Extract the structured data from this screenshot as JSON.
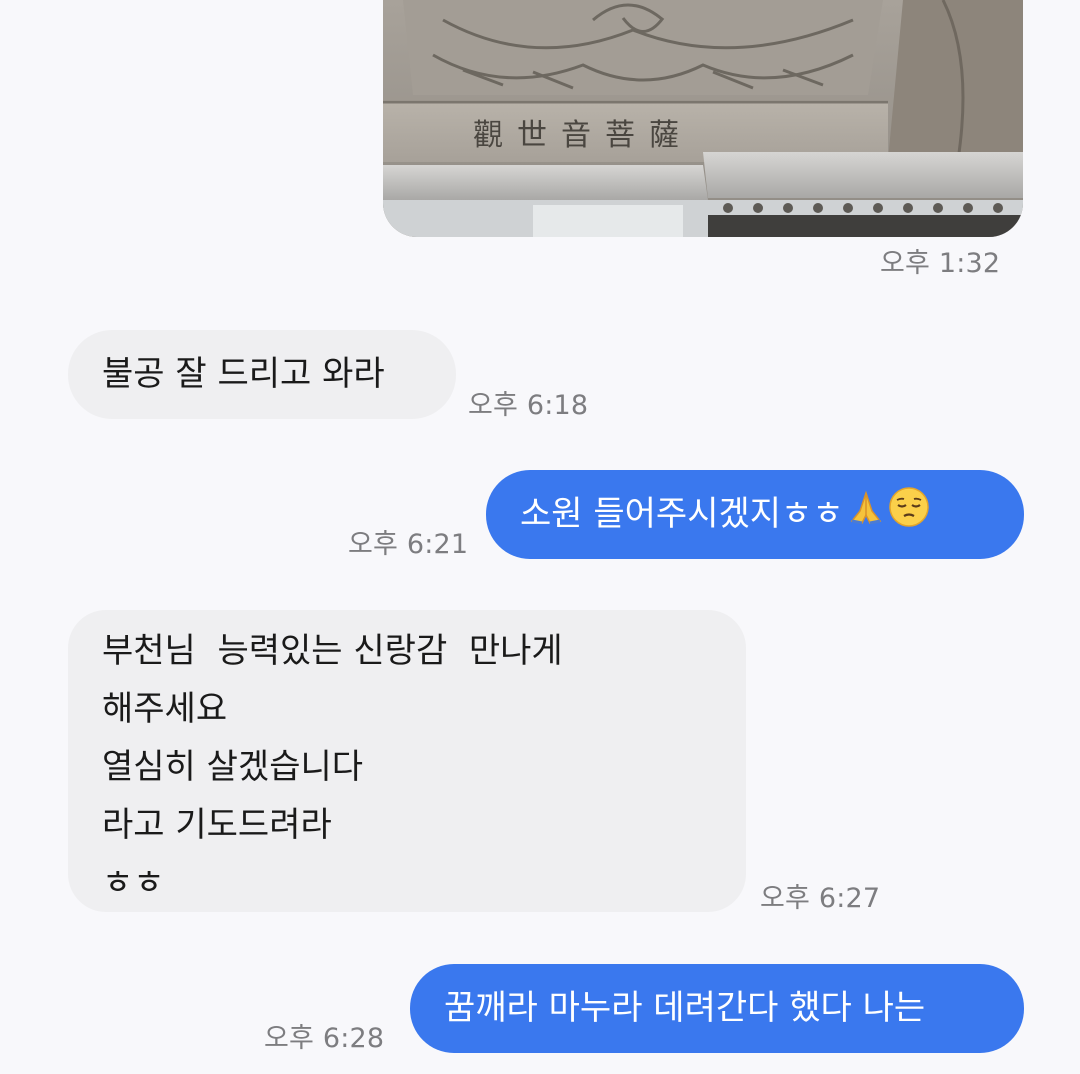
{
  "messages": [
    {
      "id": "photo",
      "direction": "outgoing",
      "type": "image",
      "image_text": "觀世音菩薩",
      "time": "오후 1:32"
    },
    {
      "id": "m1",
      "direction": "incoming",
      "type": "text",
      "lines": [
        "불공 잘 드리고 와라"
      ],
      "time": "오후 6:18"
    },
    {
      "id": "m2",
      "direction": "outgoing",
      "type": "text",
      "text": "소원 들어주시겠지ㅎㅎ",
      "emojis": [
        "folded-hands",
        "pensive-face"
      ],
      "time": "오후 6:21"
    },
    {
      "id": "m3",
      "direction": "incoming",
      "type": "text",
      "lines": [
        "부천님  능력있는 신랑감  만나게",
        "해주세요",
        "열심히 살겠습니다",
        "라고 기도드려라",
        "ㅎㅎ"
      ],
      "time": "오후 6:27"
    },
    {
      "id": "m4",
      "direction": "outgoing",
      "type": "text",
      "text": "꿈깨라 마누라 데려간다 했다 나는",
      "time": "오후 6:28"
    }
  ],
  "colors": {
    "background": "#f8f8fb",
    "incoming_bubble": "#efeff1",
    "outgoing_bubble": "#3a78ee",
    "timestamp": "#7d7d80"
  }
}
